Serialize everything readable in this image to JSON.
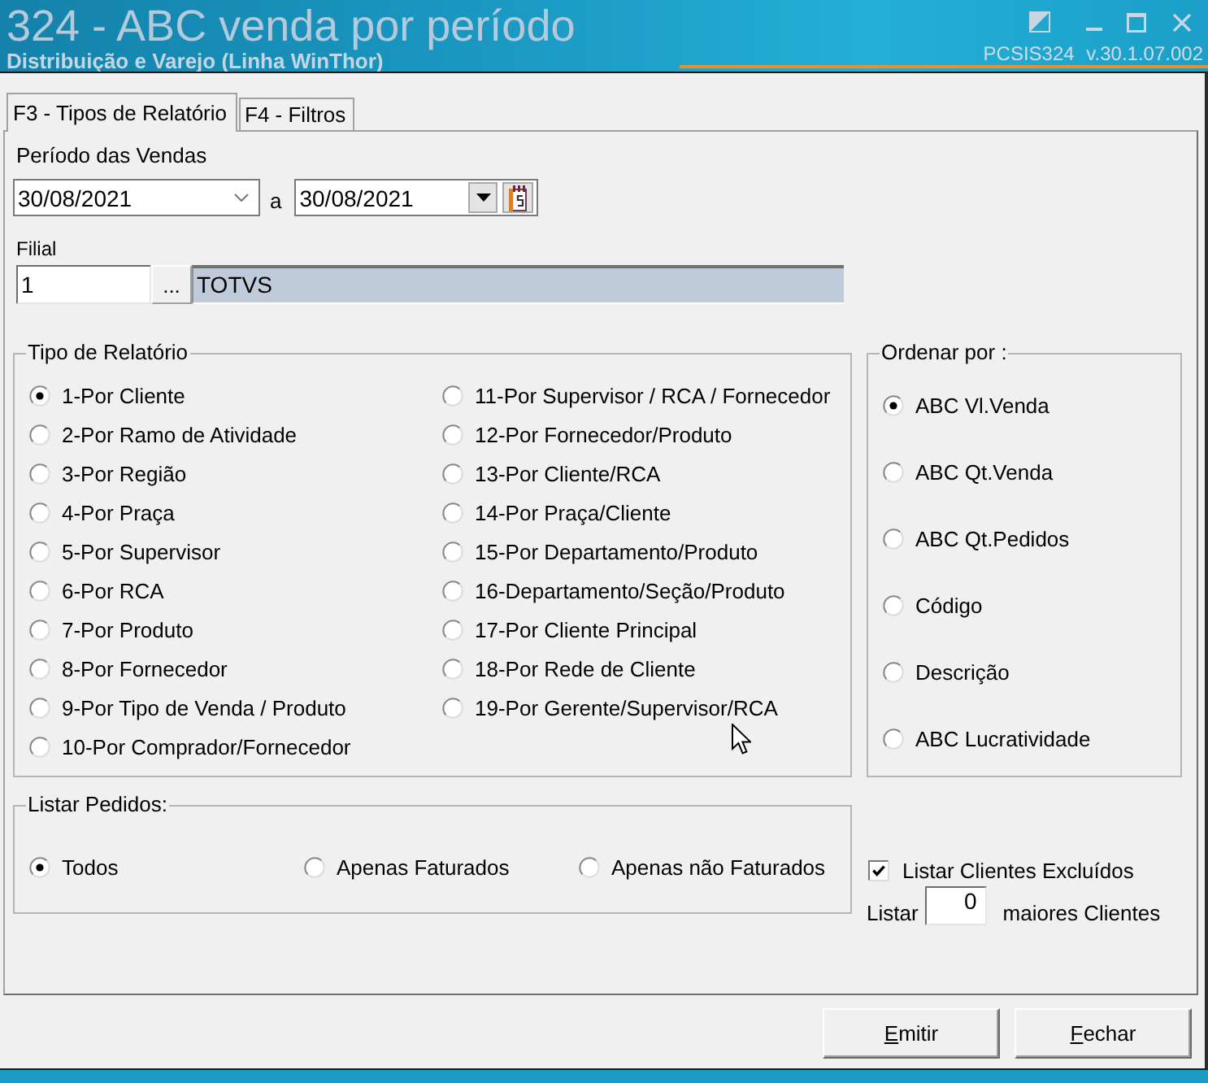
{
  "window": {
    "title": "324 - ABC venda por período",
    "subtitle": "Distribuição e Varejo (Linha WinThor)",
    "version": "PCSIS324 v.30.1.07.002"
  },
  "tabs": [
    {
      "label": "F3 - Tipos de Relatório",
      "selected": true
    },
    {
      "label": "F4 - Filtros",
      "selected": false
    }
  ],
  "period": {
    "label": "Período das Vendas",
    "start": "30/08/2021",
    "separator": "a",
    "end": "30/08/2021"
  },
  "branch": {
    "label": "Filial",
    "code": "1",
    "lookup": "...",
    "name": "TOTVS"
  },
  "report_type": {
    "title": "Tipo de Relatório",
    "options": [
      {
        "label": "1-Por Cliente",
        "selected": true
      },
      {
        "label": "2-Por Ramo de Atividade",
        "selected": false
      },
      {
        "label": "3-Por Região",
        "selected": false
      },
      {
        "label": "4-Por Praça",
        "selected": false
      },
      {
        "label": "5-Por Supervisor",
        "selected": false
      },
      {
        "label": "6-Por RCA",
        "selected": false
      },
      {
        "label": "7-Por Produto",
        "selected": false
      },
      {
        "label": "8-Por Fornecedor",
        "selected": false
      },
      {
        "label": "9-Por Tipo de Venda / Produto",
        "selected": false
      },
      {
        "label": "10-Por Comprador/Fornecedor",
        "selected": false
      },
      {
        "label": "11-Por Supervisor / RCA / Fornecedor",
        "selected": false
      },
      {
        "label": "12-Por Fornecedor/Produto",
        "selected": false
      },
      {
        "label": "13-Por Cliente/RCA",
        "selected": false
      },
      {
        "label": "14-Por Praça/Cliente",
        "selected": false
      },
      {
        "label": "15-Por Departamento/Produto",
        "selected": false
      },
      {
        "label": "16-Departamento/Seção/Produto",
        "selected": false
      },
      {
        "label": "17-Por Cliente Principal",
        "selected": false
      },
      {
        "label": "18-Por Rede de Cliente",
        "selected": false
      },
      {
        "label": "19-Por Gerente/Supervisor/RCA",
        "selected": false
      }
    ]
  },
  "sort_by": {
    "title": "Ordenar por :",
    "options": [
      {
        "label": "ABC Vl.Venda",
        "selected": true
      },
      {
        "label": "ABC Qt.Venda",
        "selected": false
      },
      {
        "label": "ABC Qt.Pedidos",
        "selected": false
      },
      {
        "label": "Código",
        "selected": false
      },
      {
        "label": "Descrição",
        "selected": false
      },
      {
        "label": "ABC Lucratividade",
        "selected": false
      }
    ]
  },
  "list_orders": {
    "title": "Listar Pedidos:",
    "options": [
      {
        "label": "Todos",
        "selected": true
      },
      {
        "label": "Apenas Faturados",
        "selected": false
      },
      {
        "label": "Apenas não Faturados",
        "selected": false
      }
    ]
  },
  "exclude_clients": {
    "label": "Listar Clientes Excluídos",
    "checked": true
  },
  "top_clients": {
    "prefix": "Listar",
    "value": "0",
    "suffix": "maiores Clientes"
  },
  "buttons": [
    {
      "label": "Emitir"
    },
    {
      "label": "Fechar"
    }
  ]
}
